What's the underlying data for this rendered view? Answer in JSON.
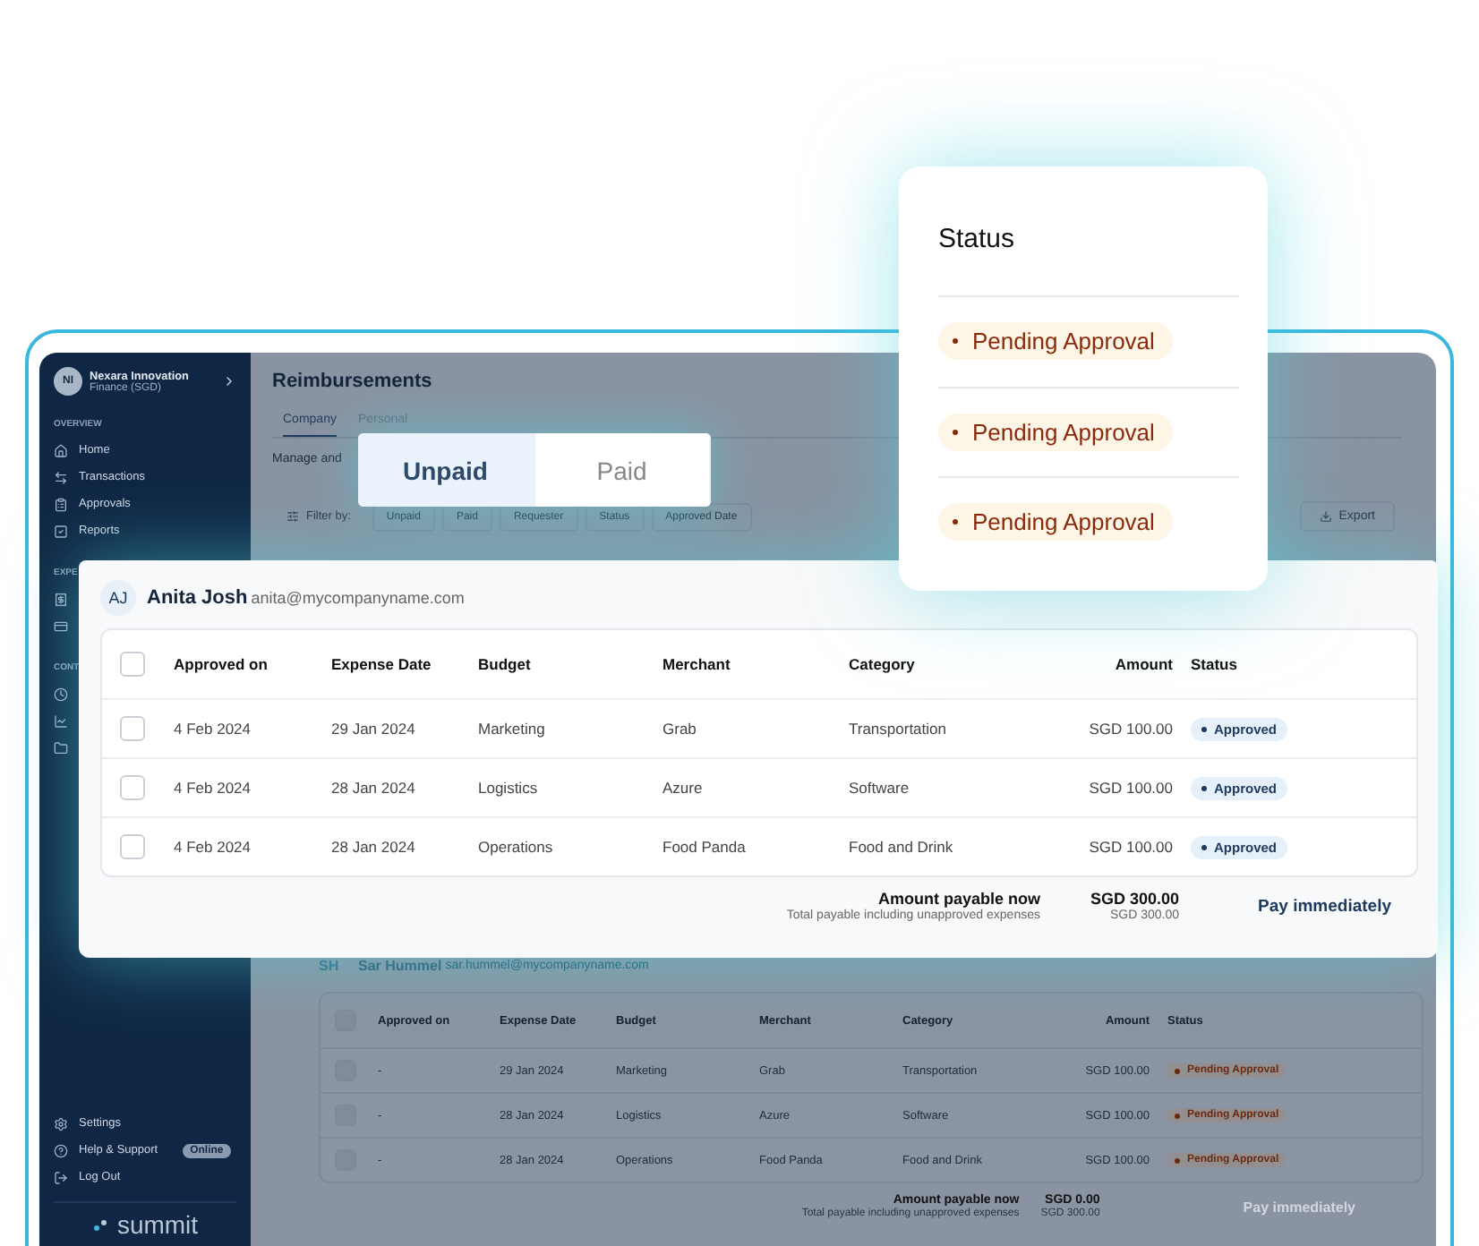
{
  "sidebar": {
    "org": {
      "initials": "NI",
      "name": "Nexara Innovation",
      "subtitle": "Finance (SGD)"
    },
    "sections": [
      {
        "label": "OVERVIEW",
        "items": [
          {
            "label": "Home"
          },
          {
            "label": "Transactions"
          },
          {
            "label": "Approvals"
          },
          {
            "label": "Reports"
          }
        ]
      },
      {
        "label": "EXPE"
      },
      {
        "label": "CONT"
      }
    ],
    "footer": [
      {
        "label": "Settings"
      },
      {
        "label": "Help & Support",
        "badge": "Online"
      },
      {
        "label": "Log Out"
      }
    ],
    "logo": "summit"
  },
  "page": {
    "title": "Reimbursements",
    "tabs": [
      {
        "label": "Company",
        "selected": true
      },
      {
        "label": "Personal",
        "selected": false
      }
    ],
    "description": "Manage and",
    "filter_label": "Filter by:",
    "filters": [
      "Unpaid",
      "Paid",
      "Requester",
      "Status",
      "Approved Date"
    ],
    "export": "Export"
  },
  "toggle": [
    {
      "label": "Unpaid",
      "selected": true
    },
    {
      "label": "Paid",
      "selected": false
    }
  ],
  "status_card": {
    "title": "Status",
    "items": [
      "Pending Approval",
      "Pending Approval",
      "Pending Approval"
    ]
  },
  "requesters": [
    {
      "focused": true,
      "initials": "AJ",
      "name": "Anita Josh",
      "email": "anita@mycompanyname.com",
      "all_checked": false,
      "columns": [
        "Approved on",
        "Expense Date",
        "Budget",
        "Merchant",
        "Category",
        "Amount",
        "Status"
      ],
      "rows": [
        {
          "checked": false,
          "cells": [
            "4 Feb 2024",
            "29 Jan 2024",
            "Marketing",
            "Grab",
            "Transportation",
            "SGD 100.00"
          ],
          "status": "Approved",
          "kind": "approved"
        },
        {
          "checked": false,
          "cells": [
            "4 Feb 2024",
            "28 Jan 2024",
            "Logistics",
            "Azure",
            "Software",
            "SGD 100.00"
          ],
          "status": "Approved",
          "kind": "approved"
        },
        {
          "checked": false,
          "cells": [
            "4 Feb 2024",
            "28 Jan 2024",
            "Operations",
            "Food Panda",
            "Food and Drink",
            "SGD 100.00"
          ],
          "status": "Approved",
          "kind": "approved"
        }
      ],
      "summary": {
        "label": "Amount payable now",
        "sublabel": "Total payable including unapproved expenses",
        "amount": "SGD 300.00",
        "total": "SGD 300.00",
        "action": {
          "label": "Pay immediately",
          "disabled": false
        }
      }
    },
    {
      "focused": false,
      "initials": "SH",
      "name": "Sar Hummel",
      "email": "sar.hummel@mycompanyname.com",
      "all_checked": false,
      "columns": [
        "Approved on",
        "Expense Date",
        "Budget",
        "Merchant",
        "Category",
        "Amount",
        "Status"
      ],
      "rows": [
        {
          "checked": false,
          "cells": [
            "-",
            "29 Jan 2024",
            "Marketing",
            "Grab",
            "Transportation",
            "SGD 100.00"
          ],
          "status": "Pending Approval",
          "kind": "pending"
        },
        {
          "checked": false,
          "cells": [
            "-",
            "28 Jan 2024",
            "Logistics",
            "Azure",
            "Software",
            "SGD 100.00"
          ],
          "status": "Pending Approval",
          "kind": "pending"
        },
        {
          "checked": false,
          "cells": [
            "-",
            "28 Jan 2024",
            "Operations",
            "Food Panda",
            "Food and Drink",
            "SGD 100.00"
          ],
          "status": "Pending Approval",
          "kind": "pending"
        }
      ],
      "summary": {
        "label": "Amount payable now",
        "sublabel": "Total payable including unapproved expenses",
        "amount": "SGD 0.00",
        "total": "SGD 300.00",
        "action": {
          "label": "Pay immediately",
          "disabled": true
        }
      }
    }
  ]
}
